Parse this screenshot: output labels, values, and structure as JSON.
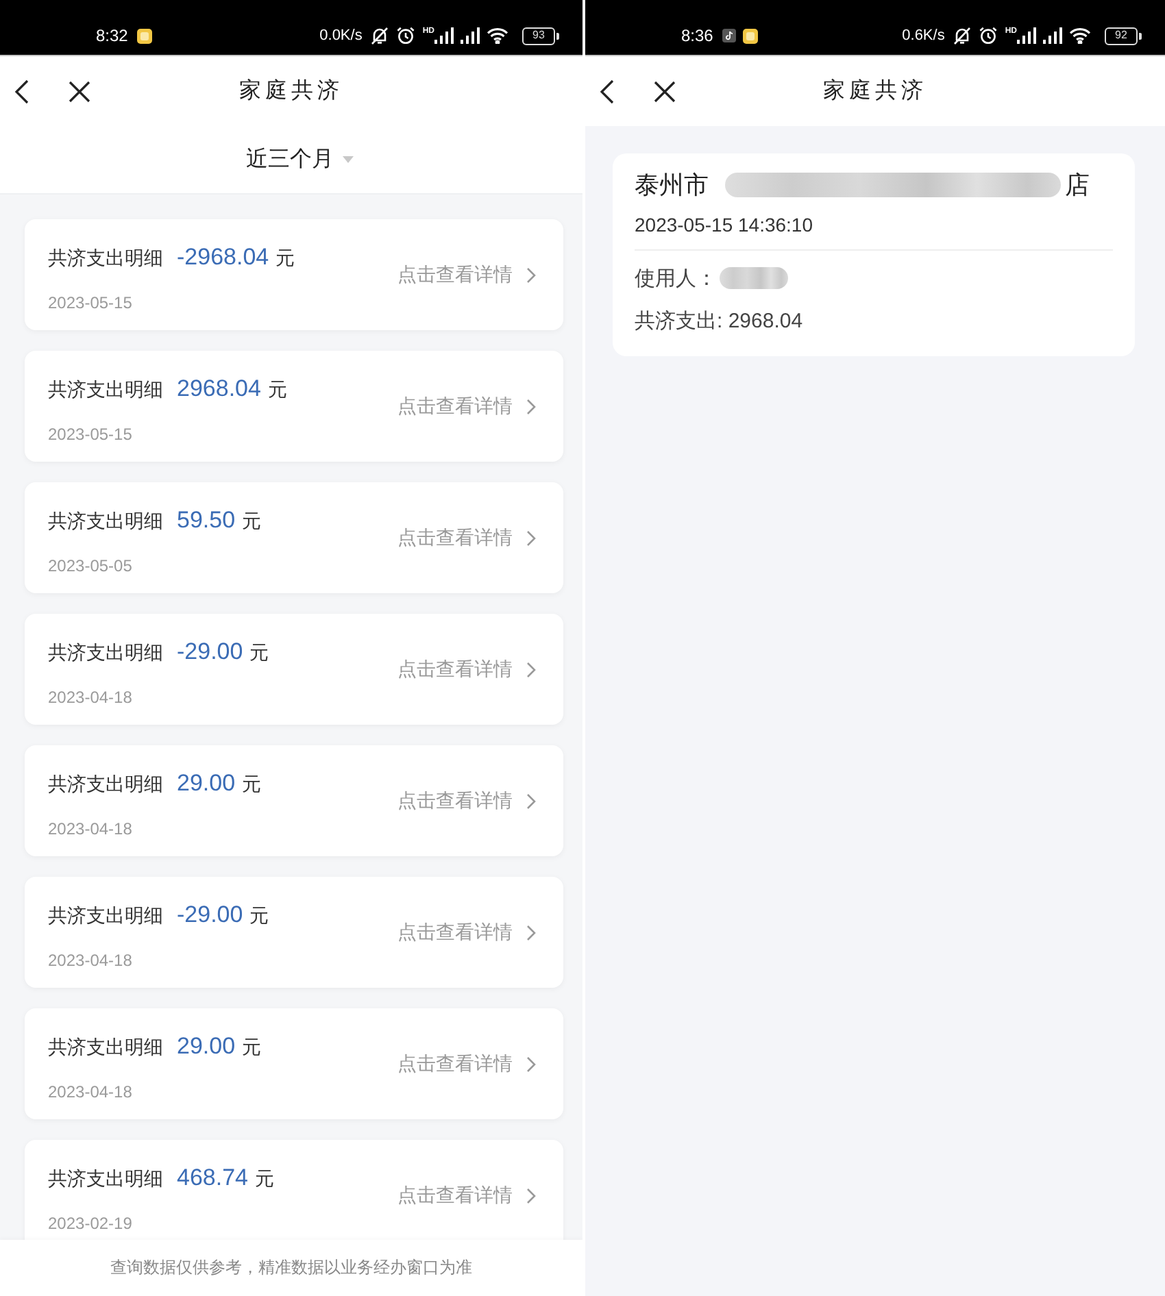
{
  "left_screen": {
    "status_bar": {
      "time": "8:32",
      "notifications": [
        {
          "kind": "tile"
        }
      ],
      "speed": "0.0K/s",
      "network_badge": "HD",
      "battery": "93"
    },
    "header": {
      "title": "家庭共济"
    },
    "filter": {
      "label": "近三个月"
    },
    "records": [
      {
        "label": "共济支出明细",
        "amount": "-2968.04",
        "unit": "元",
        "date": "2023-05-15",
        "action": "点击查看详情"
      },
      {
        "label": "共济支出明细",
        "amount": "2968.04",
        "unit": "元",
        "date": "2023-05-15",
        "action": "点击查看详情"
      },
      {
        "label": "共济支出明细",
        "amount": "59.50",
        "unit": "元",
        "date": "2023-05-05",
        "action": "点击查看详情"
      },
      {
        "label": "共济支出明细",
        "amount": "-29.00",
        "unit": "元",
        "date": "2023-04-18",
        "action": "点击查看详情"
      },
      {
        "label": "共济支出明细",
        "amount": "29.00",
        "unit": "元",
        "date": "2023-04-18",
        "action": "点击查看详情"
      },
      {
        "label": "共济支出明细",
        "amount": "-29.00",
        "unit": "元",
        "date": "2023-04-18",
        "action": "点击查看详情"
      },
      {
        "label": "共济支出明细",
        "amount": "29.00",
        "unit": "元",
        "date": "2023-04-18",
        "action": "点击查看详情"
      },
      {
        "label": "共济支出明细",
        "amount": "468.74",
        "unit": "元",
        "date": "2023-02-19",
        "action": "点击查看详情"
      }
    ],
    "footer_note": "查询数据仅供参考，精准数据以业务经办窗口为准"
  },
  "right_screen": {
    "status_bar": {
      "time": "8:36",
      "notifications": [
        {
          "kind": "note"
        },
        {
          "kind": "tile"
        }
      ],
      "speed": "0.6K/s",
      "network_badge": "HD",
      "battery": "92"
    },
    "header": {
      "title": "家庭共济"
    },
    "detail": {
      "store_name_start": "泰州市",
      "store_name_end": "店",
      "datetime": "2023-05-15 14:36:10",
      "user_label": "使用人：",
      "expense": "共济支出: 2968.04"
    }
  }
}
